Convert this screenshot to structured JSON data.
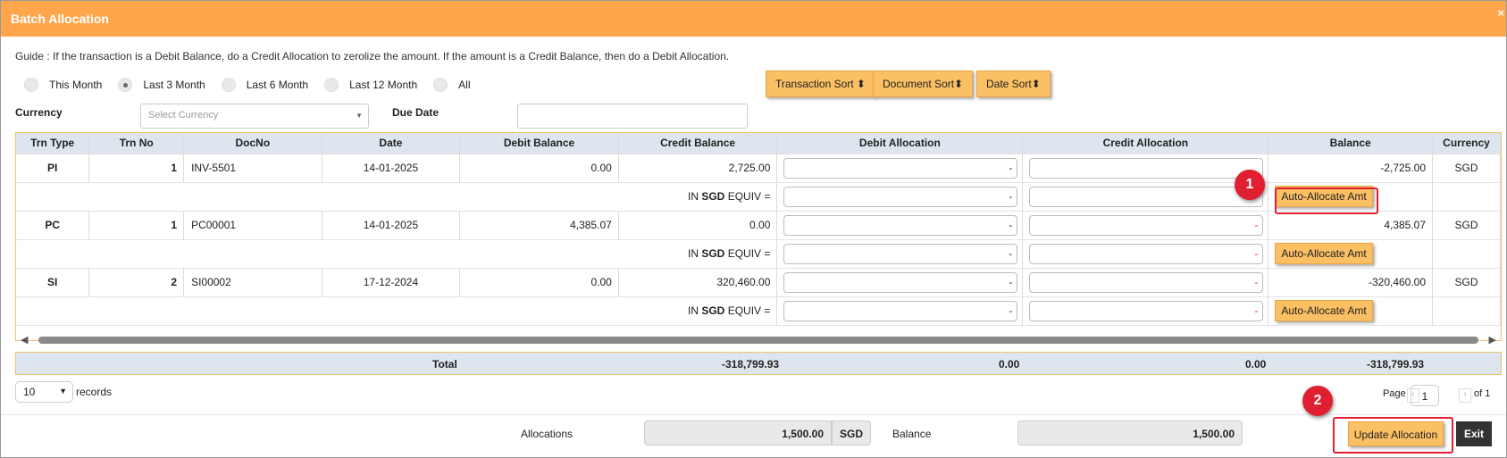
{
  "window": {
    "title": "Batch Allocation",
    "close": "×"
  },
  "guide": "Guide : If the transaction is a Debit Balance, do a Credit Allocation to zerolize the amount. If the amount is a Credit Balance, then do a Debit Allocation.",
  "period_options": [
    {
      "label": "This Month",
      "selected": false
    },
    {
      "label": "Last 3 Month",
      "selected": true
    },
    {
      "label": "Last 6 Month",
      "selected": false
    },
    {
      "label": "Last 12 Month",
      "selected": false
    },
    {
      "label": "All",
      "selected": false
    }
  ],
  "sort_buttons": {
    "transaction": "Transaction Sort ⬍",
    "document": "Document Sort⬍",
    "date": "Date Sort⬍"
  },
  "filters": {
    "currency_label": "Currency",
    "currency_placeholder": "Select Currency",
    "due_date_label": "Due Date"
  },
  "table": {
    "headers": [
      "Trn Type",
      "Trn No",
      "DocNo",
      "Date",
      "Debit Balance",
      "Credit Balance",
      "Debit Allocation",
      "Credit Allocation",
      "Balance",
      "Currency"
    ],
    "equiv_prefix": "IN ",
    "equiv_currency": "SGD",
    "equiv_suffix": " EQUIV =",
    "auto_allocate_label": "Auto-Allocate Amt",
    "dash": "-",
    "rows": [
      {
        "type": "PI",
        "no": "1",
        "doc": "INV-5501",
        "date": "14-01-2025",
        "debit": "0.00",
        "credit": "2,725.00",
        "balance": "-2,725.00",
        "currency": "SGD"
      },
      {
        "type": "PC",
        "no": "1",
        "doc": "PC00001",
        "date": "14-01-2025",
        "debit": "4,385.07",
        "credit": "0.00",
        "balance": "4,385.07",
        "currency": "SGD"
      },
      {
        "type": "SI",
        "no": "2",
        "doc": "SI00002",
        "date": "17-12-2024",
        "debit": "0.00",
        "credit": "320,460.00",
        "balance": "-320,460.00",
        "currency": "SGD"
      }
    ],
    "totals": {
      "label": "Total",
      "credit": "-318,799.93",
      "debit_alloc": "0.00",
      "credit_alloc": "0.00",
      "balance": "-318,799.93"
    }
  },
  "pagination": {
    "page_size": "10",
    "records_label": "records",
    "page_label": "Page",
    "page": "1",
    "of_label": "of 1"
  },
  "footer": {
    "allocations_label": "Allocations",
    "allocations_value": "1,500.00",
    "allocations_currency": "SGD",
    "balance_label": "Balance",
    "balance_value": "1,500.00",
    "update_label": "Update Allocation",
    "exit_label": "Exit"
  },
  "markers": [
    "1",
    "2"
  ],
  "colors": {
    "title_bar": "#ffa64d",
    "button": "#fbc063",
    "header_row": "#dde5ee",
    "highlight": "#e02030"
  }
}
